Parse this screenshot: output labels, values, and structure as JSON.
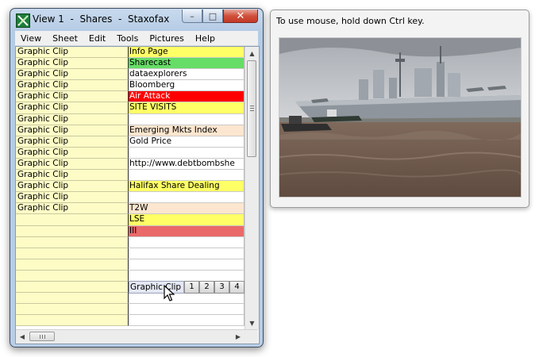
{
  "window": {
    "title": "View 1  -  Shares  -  Staxofax",
    "controls": {
      "minimize": "–",
      "maximize": "□",
      "close": "✕"
    }
  },
  "menu": [
    "View",
    "Sheet",
    "Edit",
    "Tools",
    "Pictures",
    "Help"
  ],
  "sheet": {
    "rows": [
      {
        "a": "Graphic Clip",
        "b": "Info Page",
        "b_bg": "#ffff66",
        "b_color": "#000000"
      },
      {
        "a": "Graphic Clip",
        "b": "Sharecast",
        "b_bg": "#66dd66",
        "b_color": "#000000"
      },
      {
        "a": "Graphic Clip",
        "b": "dataexplorers",
        "b_bg": "#ffffff",
        "b_color": "#000000"
      },
      {
        "a": "Graphic Clip",
        "b": "Bloomberg",
        "b_bg": "#ffffff",
        "b_color": "#000000"
      },
      {
        "a": "Graphic Clip",
        "b": "Air Attack",
        "b_bg": "#ff0000",
        "b_color": "#ffffff"
      },
      {
        "a": "Graphic Clip",
        "b": "SITE VISITS",
        "b_bg": "#ffff66",
        "b_color": "#000000"
      },
      {
        "a": "Graphic Clip",
        "b": "",
        "b_bg": "#ffffff",
        "b_color": "#000000"
      },
      {
        "a": "Graphic Clip",
        "b": "Emerging Mkts Index",
        "b_bg": "#fde6cf",
        "b_color": "#000000"
      },
      {
        "a": "Graphic Clip",
        "b": "Gold Price",
        "b_bg": "#ffffff",
        "b_color": "#000000"
      },
      {
        "a": "Graphic Clip",
        "b": "",
        "b_bg": "#ffffff",
        "b_color": "#000000"
      },
      {
        "a": "Graphic Clip",
        "b": "http://www.debtbombshe",
        "b_bg": "#ffffff",
        "b_color": "#000000"
      },
      {
        "a": "Graphic Clip",
        "b": "",
        "b_bg": "#ffffff",
        "b_color": "#000000"
      },
      {
        "a": "Graphic Clip",
        "b": "Halifax Share Dealing",
        "b_bg": "#ffff66",
        "b_color": "#000000"
      },
      {
        "a": "Graphic Clip",
        "b": "",
        "b_bg": "#ffffff",
        "b_color": "#000000"
      },
      {
        "a": "Graphic Clip",
        "b": "T2W",
        "b_bg": "#fde6cf",
        "b_color": "#000000"
      },
      {
        "a": "",
        "b": "LSE",
        "b_bg": "#ffff66",
        "b_color": "#000000"
      },
      {
        "a": "",
        "b": "III",
        "b_bg": "#ea6a6a",
        "b_color": "#000000"
      },
      {
        "a": "",
        "b": "",
        "b_bg": "#ffffff",
        "b_color": "#000000"
      },
      {
        "a": "",
        "b": "",
        "b_bg": "#ffffff",
        "b_color": "#000000"
      },
      {
        "a": "",
        "b": "",
        "b_bg": "#ffffff",
        "b_color": "#000000"
      },
      {
        "a": "",
        "b": "",
        "b_bg": "#ffffff",
        "b_color": "#000000"
      },
      {
        "a": "",
        "b": "",
        "b_bg": "#ffffff",
        "b_color": "#000000"
      },
      {
        "a": "",
        "b": "",
        "b_bg": "#ffffff",
        "b_color": "#000000"
      },
      {
        "a": "",
        "b": "",
        "b_bg": "#ffffff",
        "b_color": "#000000"
      },
      {
        "a": "",
        "b": "",
        "b_bg": "#ffffff",
        "b_color": "#000000"
      }
    ],
    "tabstrip": {
      "label": "Graphic Clip",
      "tabs": [
        "1",
        "2",
        "3",
        "4"
      ]
    },
    "scrollbar": {
      "up": "▲",
      "down": "▼",
      "left": "◀",
      "right": "▶"
    }
  },
  "picture_window": {
    "hint": "To use mouse, hold down Ctrl key.",
    "image": "aircraft-carrier-photo"
  }
}
